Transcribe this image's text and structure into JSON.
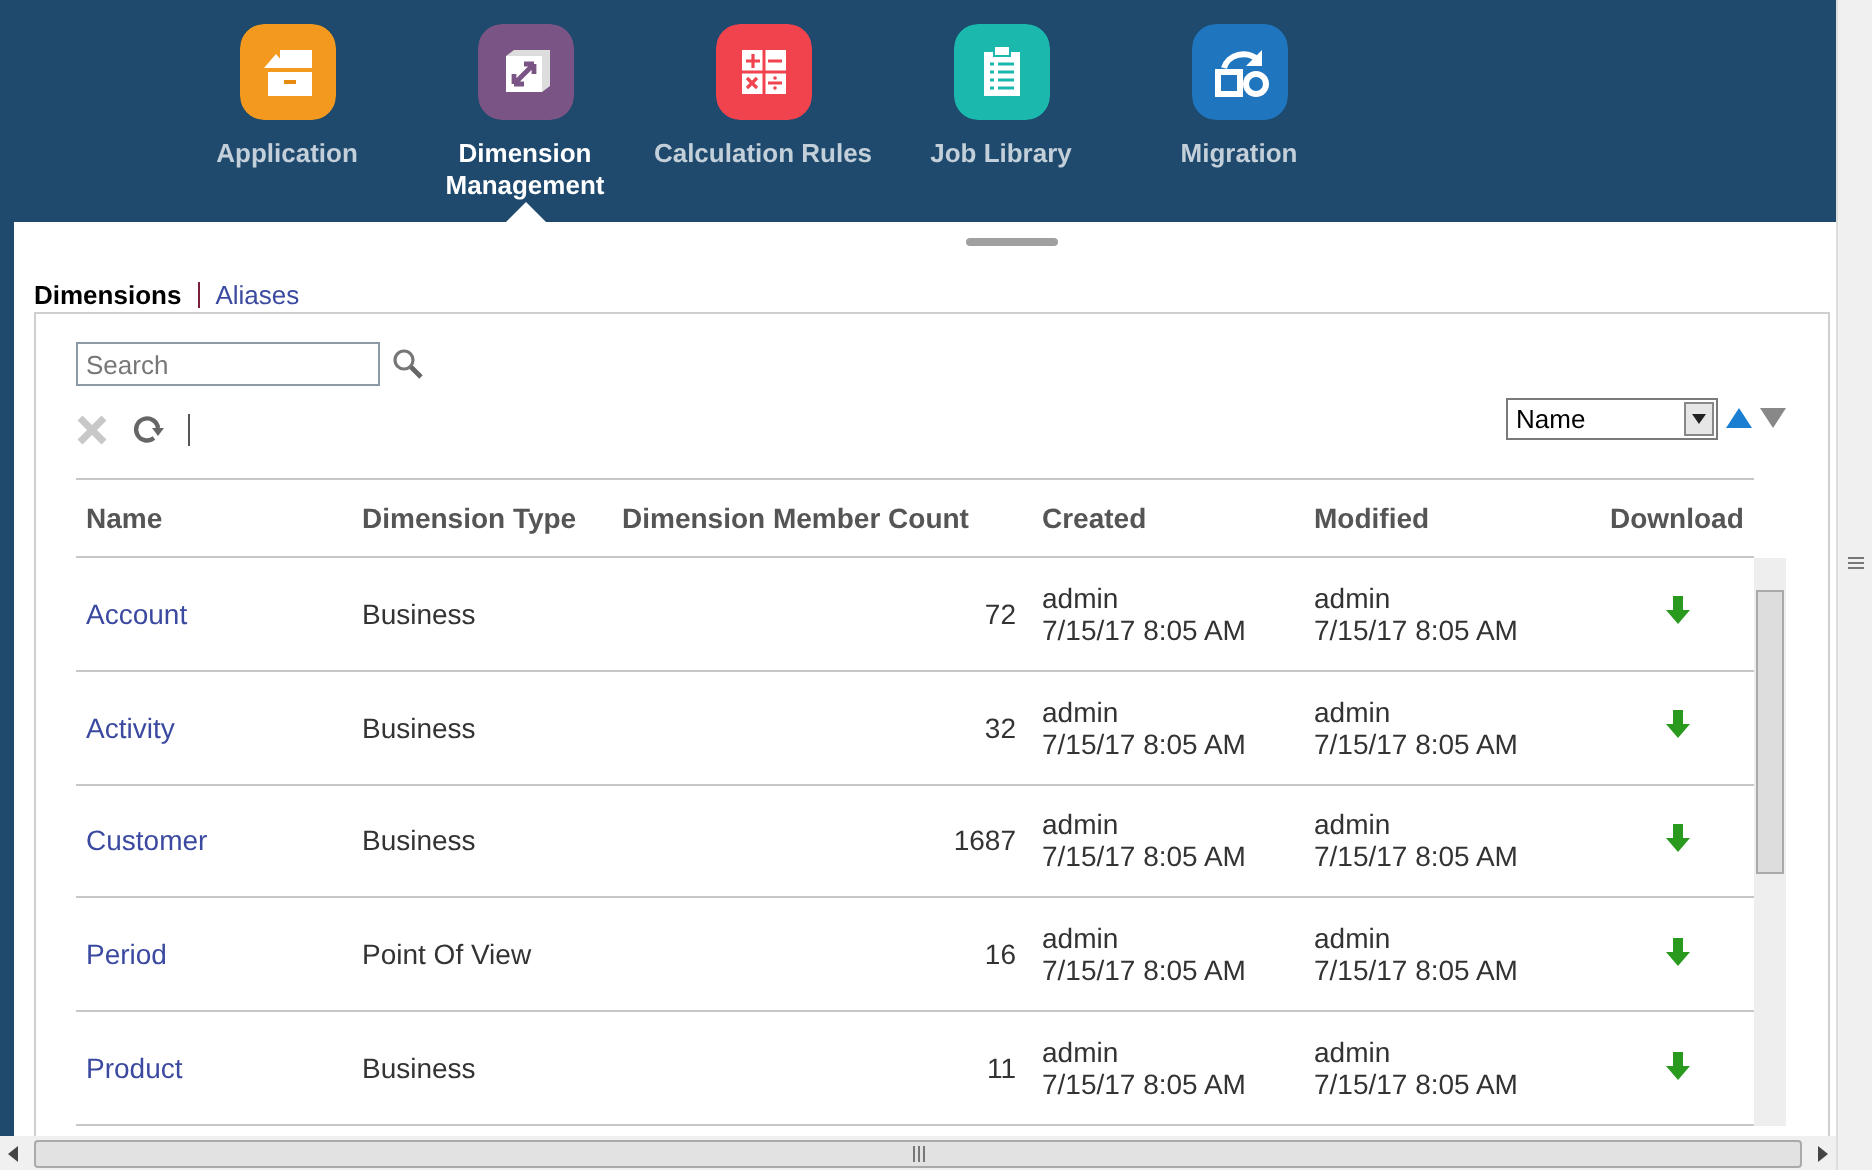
{
  "nav": [
    {
      "label": "Application",
      "kind": "application",
      "color": "#f39a1e",
      "selected": false
    },
    {
      "label": "Dimension Management",
      "kind": "dimension",
      "color": "#7a5484",
      "selected": true
    },
    {
      "label": "Calculation Rules",
      "kind": "calculation",
      "color": "#f0434e",
      "selected": false
    },
    {
      "label": "Job Library",
      "kind": "job",
      "color": "#1bb8ad",
      "selected": false
    },
    {
      "label": "Migration",
      "kind": "migration",
      "color": "#1f76bf",
      "selected": false
    }
  ],
  "tabs": [
    {
      "label": "Dimensions",
      "selected": true
    },
    {
      "label": "Aliases",
      "selected": false
    }
  ],
  "search": {
    "placeholder": "Search"
  },
  "toolbar": {
    "delete_disabled": true
  },
  "sort": {
    "value": "Name",
    "ascending": true
  },
  "table": {
    "columns": [
      "Name",
      "Dimension Type",
      "Dimension Member Count",
      "Created",
      "Modified",
      "Download"
    ],
    "rows": [
      {
        "name": "Account",
        "type": "Business",
        "count": "72",
        "created_by": "admin",
        "created_at": "7/15/17 8:05 AM",
        "modified_by": "admin",
        "modified_at": "7/15/17 8:05 AM"
      },
      {
        "name": "Activity",
        "type": "Business",
        "count": "32",
        "created_by": "admin",
        "created_at": "7/15/17 8:05 AM",
        "modified_by": "admin",
        "modified_at": "7/15/17 8:05 AM"
      },
      {
        "name": "Customer",
        "type": "Business",
        "count": "1687",
        "created_by": "admin",
        "created_at": "7/15/17 8:05 AM",
        "modified_by": "admin",
        "modified_at": "7/15/17 8:05 AM"
      },
      {
        "name": "Period",
        "type": "Point Of View",
        "count": "16",
        "created_by": "admin",
        "created_at": "7/15/17 8:05 AM",
        "modified_by": "admin",
        "modified_at": "7/15/17 8:05 AM"
      },
      {
        "name": "Product",
        "type": "Business",
        "count": "11",
        "created_by": "admin",
        "created_at": "7/15/17 8:05 AM",
        "modified_by": "admin",
        "modified_at": "7/15/17 8:05 AM"
      }
    ]
  }
}
